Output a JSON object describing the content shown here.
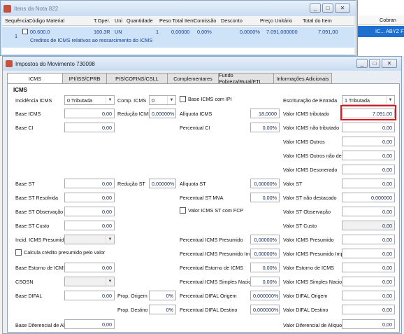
{
  "bg_window": {
    "title": "Itens da Nota 822",
    "columns": [
      "Sequência",
      "Código Material",
      "T.Oper.",
      "Uni",
      "Quantidade",
      "Peso Total Item",
      "Comissão",
      "Desconto",
      "Preço Unitário",
      "Total do Item"
    ],
    "row": {
      "seq": "1",
      "code": "00.600.0",
      "desc": "Creditos de ICMS relativos ao ressarcimento do ICMS",
      "toper": "160.3R",
      "uni": "UN",
      "qtd": "1",
      "peso": "0,00000",
      "comissao": "0,00%",
      "desconto": "0,0000%",
      "preco": "7.091,000000",
      "total": "7.091,00"
    }
  },
  "right_strip": {
    "header": "Cobran",
    "selected": "IC... ABYZ F"
  },
  "dialog": {
    "title": "Impostos do Movimento 730098",
    "tabs": [
      "ICMS",
      "IPI/ISS/CPRB",
      "PIS/COFINS/CSLL",
      "Complementares",
      "Fundo Pobreza/Rural/FTI",
      "Informações Adicionais"
    ],
    "section": "ICMS",
    "col1": {
      "incidencia_label": "Incidência ICMS",
      "incidencia_value": "0 Tributada",
      "base_icms_label": "Base ICMS",
      "base_icms": "0,00",
      "base_ci_label": "Base CI",
      "base_ci": "0,00",
      "base_st_label": "Base ST",
      "base_st": "0,00",
      "base_st_resolvida_label": "Base ST Resolvida",
      "base_st_resolvida": "0,00",
      "base_st_obs_label": "Base ST Observação",
      "base_st_obs": "0,00",
      "base_st_custo_label": "Base ST Custo",
      "base_st_custo": "0,00",
      "incid_presumido_label": "Incid. ICMS Presumido",
      "calcula_credito_label": "Calcula crédito presumido pelo valor",
      "base_estorno_label": "Base Estorno de ICMS",
      "base_estorno": "0,00",
      "csosn_label": "CSOSN",
      "base_difal_label": "Base DIFAL",
      "base_difal": "0,00",
      "base_dif_aliq_label": "Base Diferencial de Aliq.",
      "base_dif_aliq": "0,00"
    },
    "col2": {
      "comp_icms_label": "Comp. ICMS",
      "comp_icms_value": "0",
      "reducao_icms_label": "Redução ICMS",
      "reducao_icms": "0,00000%",
      "reducao_st_label": "Redução ST",
      "reducao_st": "0,00000%",
      "prop_origem_label": "Prop. Origem",
      "prop_origem": "0%",
      "prop_destino_label": "Prop. Destino",
      "prop_destino": "0%"
    },
    "col3": {
      "base_icms_ipi_label": "Base ICMS com IPI",
      "aliquota_icms_label": "Alíquota ICMS",
      "aliquota_icms": "18,0000",
      "percentual_ci_label": "Percentual CI",
      "percentual_ci": "0,00%",
      "aliquota_st_label": "Alíquota ST",
      "aliquota_st": "0,00000%",
      "percentual_st_mva_label": "Percentual ST MVA",
      "percentual_st_mva": "0,00%",
      "valor_icms_st_fcp_label": "Valor ICMS ST com FCP",
      "pct_presumido_label": "Percentual ICMS Presumido",
      "pct_presumido": "0,00000%",
      "pct_presumido_imp_label": "Percentual ICMS Presumido Imp. PR",
      "pct_presumido_imp": "0,00000%",
      "pct_estorno_label": "Percentual Estorno de ICMS",
      "pct_estorno": "0,00%",
      "pct_simples_label": "Percentual ICMS Simples Nacional",
      "pct_simples": "0,00%",
      "pct_difal_origem_label": "Percentual DIFAL Origem",
      "pct_difal_origem": "0,000000%",
      "pct_difal_destino_label": "Percentual DIFAL Destino",
      "pct_difal_destino": "0,000000%"
    },
    "col4": {
      "escrituracao_label": "Escrituração de Entrada",
      "escrituracao_value": "1 Tributada",
      "valor_tributado_label": "Valor ICMS tributado",
      "valor_tributado": "7.091,00",
      "valor_nao_tributado_label": "Valor ICMS não tributado",
      "valor_nao_tributado": "0,00",
      "valor_outros_label": "Valor ICMS Outros",
      "valor_outros": "0,00",
      "valor_outros_nao_dest_label": "Valor ICMS Outros não dest.",
      "valor_outros_nao_dest": "0,00",
      "valor_desonerado_label": "Valor ICMS Desonerado",
      "valor_desonerado": "0,00",
      "valor_st_label": "Valor ST",
      "valor_st": "0,00",
      "valor_st_nao_dest_label": "Valor ST não destacado",
      "valor_st_nao_dest": "0,000000",
      "valor_st_obs_label": "Valor ST Observação",
      "valor_st_obs": "0,00",
      "valor_st_custo_label": "Valor ST Custo",
      "valor_st_custo": "0,00",
      "valor_presumido_label": "Valor ICMS Presumido",
      "valor_presumido": "0,00",
      "valor_presumido_imp_label": "Valor ICMS Presumido Imp. PR",
      "valor_presumido_imp": "0,00",
      "valor_estorno_label": "Valor Estorno de ICMS",
      "valor_estorno": "0,00",
      "valor_simples_label": "Valor ICMS Simples Nacional",
      "valor_simples": "0,00",
      "valor_difal_origem_label": "Valor DIFAL Origem",
      "valor_difal_origem": "0,00",
      "valor_difal_destino_label": "Valor DIFAL Destino",
      "valor_difal_destino": "0,00",
      "valor_dif_aliquota_label": "Valor Diferencial de Alíquota",
      "valor_dif_aliquota": "0,00"
    }
  }
}
